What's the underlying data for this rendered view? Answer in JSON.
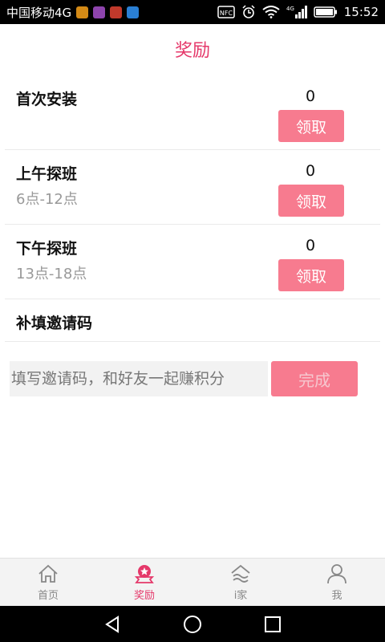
{
  "status_bar": {
    "carrier": "中国移动4G",
    "time": "15:52",
    "network_badge": "4G",
    "nfc_label": "NFC",
    "app_icon_colors": [
      "#d48a16",
      "#8e44ad",
      "#c0392b",
      "#2a7fd4"
    ]
  },
  "header": {
    "title": "奖励"
  },
  "rewards": [
    {
      "name": "首次安装",
      "subtitle": "",
      "count": "0",
      "button": "领取"
    },
    {
      "name": "上午探班",
      "subtitle": "6点-12点",
      "count": "0",
      "button": "领取"
    },
    {
      "name": "下午探班",
      "subtitle": "13点-18点",
      "count": "0",
      "button": "领取"
    }
  ],
  "invite": {
    "label": "补填邀请码",
    "placeholder": "填写邀请码，和好友一起赚积分",
    "submit": "完成"
  },
  "tabs": [
    {
      "label": "首页",
      "icon": "home-icon",
      "active": false
    },
    {
      "label": "奖励",
      "icon": "reward-icon",
      "active": true
    },
    {
      "label": "i家",
      "icon": "ijia-icon",
      "active": false
    },
    {
      "label": "我",
      "icon": "profile-icon",
      "active": false
    }
  ],
  "colors": {
    "accent": "#e5386a",
    "button": "#f77b8f",
    "tab_inactive": "#888888"
  }
}
